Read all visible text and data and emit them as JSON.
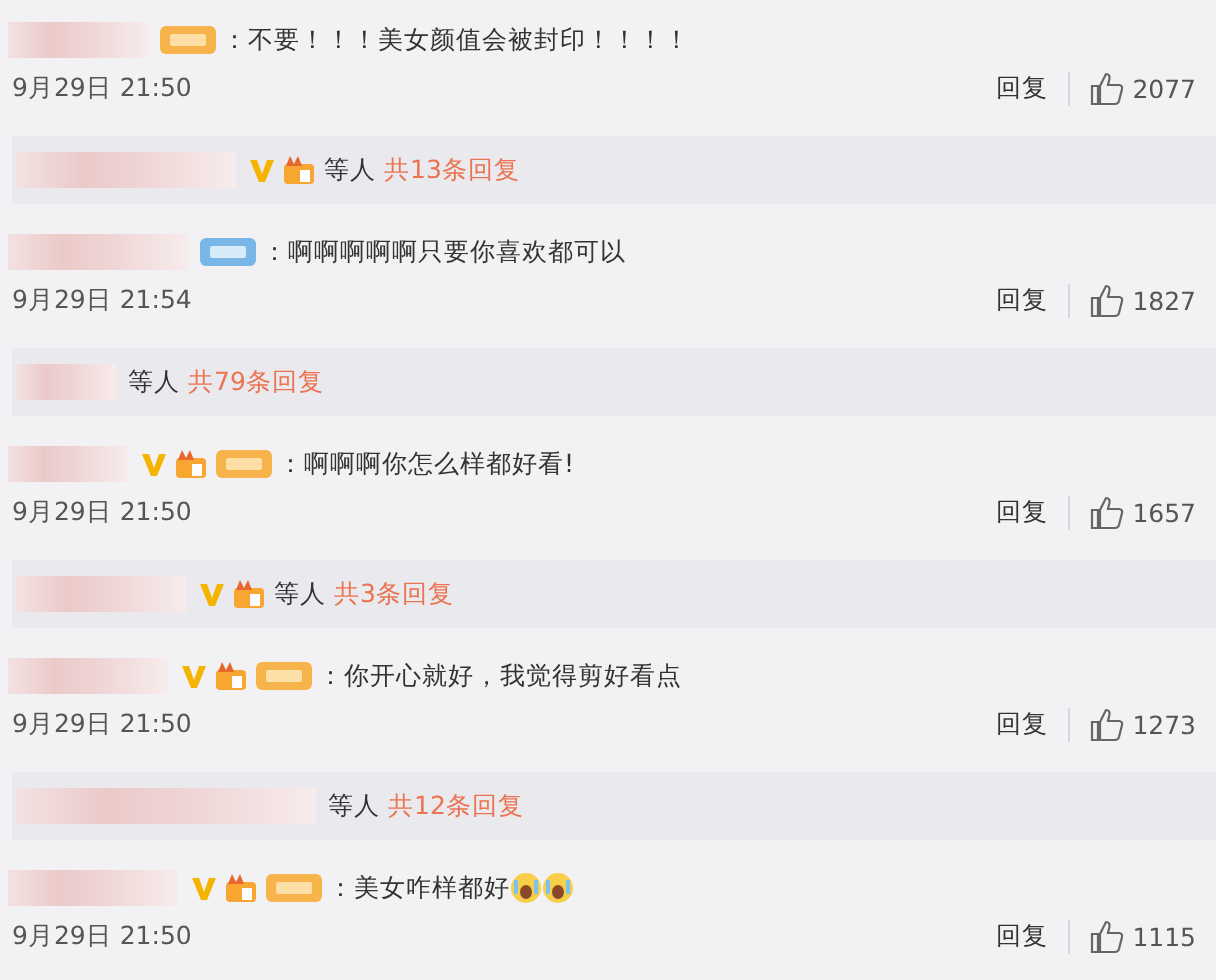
{
  "comments": [
    {
      "badges": [
        {
          "kind": "fan-tag"
        }
      ],
      "text": "：不要！！！美女颜值会被封印！！！！",
      "time": "9月29日 21:50",
      "reply": "回复",
      "likes": "2077",
      "thread": {
        "badges": [
          {
            "kind": "verified"
          },
          {
            "kind": "fan-level"
          }
        ],
        "others": "等人",
        "count": "共13条回复"
      }
    },
    {
      "badges": [
        {
          "kind": "blue-tag"
        }
      ],
      "text": "：啊啊啊啊啊只要你喜欢都可以",
      "time": "9月29日 21:54",
      "reply": "回复",
      "likes": "1827",
      "thread": {
        "others": "等人",
        "count": "共79条回复"
      }
    },
    {
      "badges": [
        {
          "kind": "verified"
        },
        {
          "kind": "fan-level"
        },
        {
          "kind": "fan-tag"
        }
      ],
      "text": "：啊啊啊你怎么样都好看!",
      "time": "9月29日 21:50",
      "reply": "回复",
      "likes": "1657",
      "thread": {
        "badges": [
          {
            "kind": "verified"
          },
          {
            "kind": "fan-level"
          }
        ],
        "others": "等人",
        "count": "共3条回复"
      }
    },
    {
      "badges": [
        {
          "kind": "verified"
        },
        {
          "kind": "fan-level"
        },
        {
          "kind": "fan-tag"
        }
      ],
      "text": "：你开心就好，我觉得剪好看点",
      "time": "9月29日 21:50",
      "reply": "回复",
      "likes": "1273",
      "thread": {
        "others": "等人",
        "count": "共12条回复"
      }
    },
    {
      "badges": [
        {
          "kind": "verified"
        },
        {
          "kind": "fan-level"
        },
        {
          "kind": "fan-tag"
        }
      ],
      "text": "：美女咋样都好",
      "trailing": [
        {
          "kind": "emoji"
        },
        {
          "kind": "emoji"
        }
      ],
      "time": "9月29日 21:50",
      "reply": "回复",
      "likes": "1115"
    }
  ]
}
